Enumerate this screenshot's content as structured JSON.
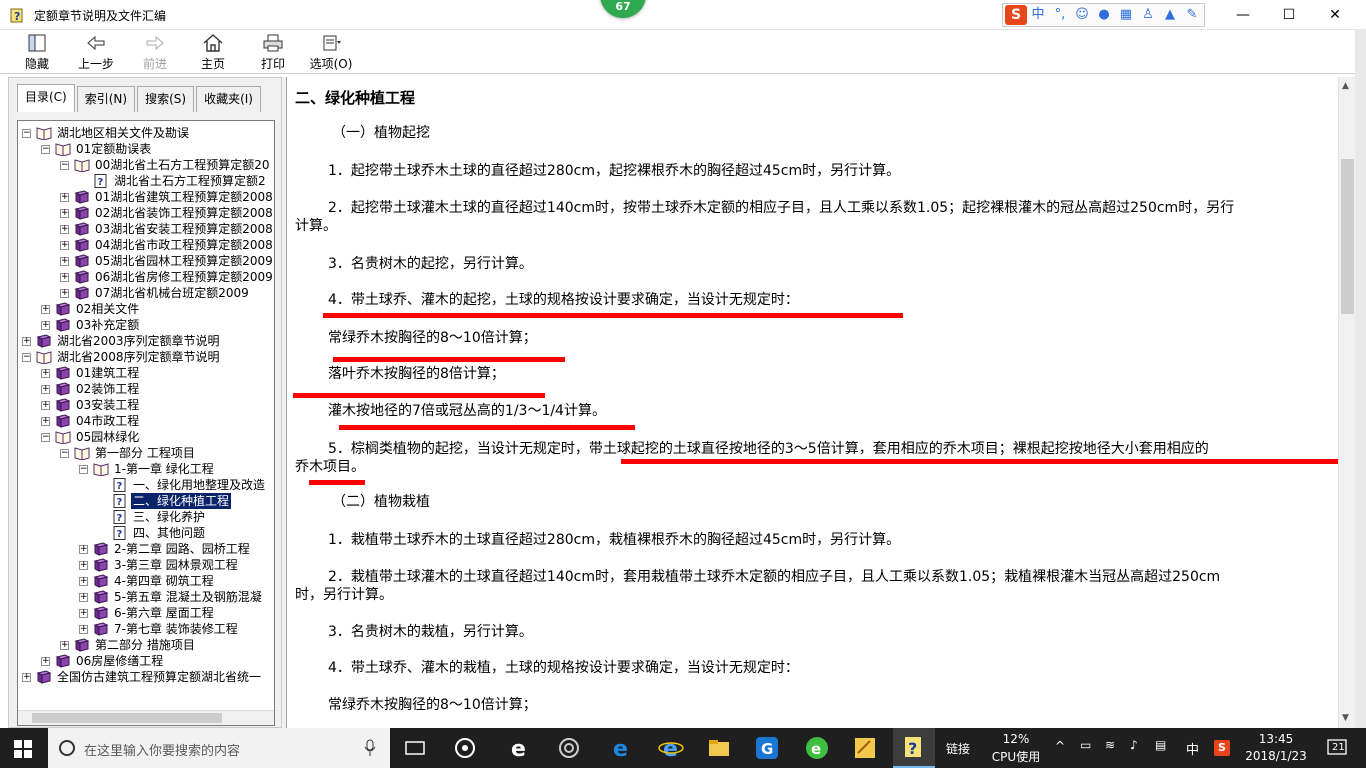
{
  "window": {
    "title": "定额章节说明及文件汇编",
    "badge": "67",
    "minimize": "—",
    "maximize": "☐",
    "close": "✕"
  },
  "ime": {
    "logo": "S",
    "lang": "中",
    "punct": "°,"
  },
  "toolbar": [
    {
      "label": "隐藏",
      "icon": "hide-icon",
      "enabled": true
    },
    {
      "label": "上一步",
      "icon": "back-arrow-icon",
      "enabled": true
    },
    {
      "label": "前进",
      "icon": "forward-arrow-icon",
      "enabled": false
    },
    {
      "label": "主页",
      "icon": "home-icon",
      "enabled": true
    },
    {
      "label": "打印",
      "icon": "printer-icon",
      "enabled": true
    },
    {
      "label": "选项(O)",
      "icon": "options-icon",
      "enabled": true
    }
  ],
  "tabs": [
    "目录(C)",
    "索引(N)",
    "搜索(S)",
    "收藏夹(I)"
  ],
  "tree": [
    {
      "label": "湖北地区相关文件及勘误",
      "level": 0,
      "exp": "−",
      "icon": "book-open"
    },
    {
      "label": "01定额勘误表",
      "level": 1,
      "exp": "−",
      "icon": "book-open"
    },
    {
      "label": "00湖北省土石方工程预算定额20",
      "level": 2,
      "exp": "−",
      "icon": "book-open"
    },
    {
      "label": "湖北省土石方工程预算定额2",
      "level": 3,
      "exp": "",
      "icon": "page"
    },
    {
      "label": "01湖北省建筑工程预算定额2008",
      "level": 2,
      "exp": "+",
      "icon": "book"
    },
    {
      "label": "02湖北省装饰工程预算定额2008",
      "level": 2,
      "exp": "+",
      "icon": "book"
    },
    {
      "label": "03湖北省安装工程预算定额2008",
      "level": 2,
      "exp": "+",
      "icon": "book"
    },
    {
      "label": "04湖北省市政工程预算定额2008",
      "level": 2,
      "exp": "+",
      "icon": "book"
    },
    {
      "label": "05湖北省园林工程预算定额2009",
      "level": 2,
      "exp": "+",
      "icon": "book"
    },
    {
      "label": "06湖北省房修工程预算定额2009",
      "level": 2,
      "exp": "+",
      "icon": "book"
    },
    {
      "label": "07湖北省机械台班定额2009",
      "level": 2,
      "exp": "+",
      "icon": "book"
    },
    {
      "label": "02相关文件",
      "level": 1,
      "exp": "+",
      "icon": "book"
    },
    {
      "label": "03补充定额",
      "level": 1,
      "exp": "+",
      "icon": "book"
    },
    {
      "label": "湖北省2003序列定额章节说明",
      "level": 0,
      "exp": "+",
      "icon": "book"
    },
    {
      "label": "湖北省2008序列定额章节说明",
      "level": 0,
      "exp": "−",
      "icon": "book-open"
    },
    {
      "label": "01建筑工程",
      "level": 1,
      "exp": "+",
      "icon": "book"
    },
    {
      "label": "02装饰工程",
      "level": 1,
      "exp": "+",
      "icon": "book"
    },
    {
      "label": "03安装工程",
      "level": 1,
      "exp": "+",
      "icon": "book"
    },
    {
      "label": "04市政工程",
      "level": 1,
      "exp": "+",
      "icon": "book"
    },
    {
      "label": "05园林绿化",
      "level": 1,
      "exp": "−",
      "icon": "book-open"
    },
    {
      "label": "第一部分 工程项目",
      "level": 2,
      "exp": "−",
      "icon": "book-open"
    },
    {
      "label": "1-第一章 绿化工程",
      "level": 3,
      "exp": "−",
      "icon": "book-open"
    },
    {
      "label": "一、绿化用地整理及改造",
      "level": 4,
      "exp": "",
      "icon": "page"
    },
    {
      "label": "二、绿化种植工程",
      "level": 4,
      "exp": "",
      "icon": "page",
      "selected": true
    },
    {
      "label": "三、绿化养护",
      "level": 4,
      "exp": "",
      "icon": "page"
    },
    {
      "label": "四、其他问题",
      "level": 4,
      "exp": "",
      "icon": "page"
    },
    {
      "label": "2-第二章 园路、园桥工程",
      "level": 3,
      "exp": "+",
      "icon": "book"
    },
    {
      "label": "3-第三章 园林景观工程",
      "level": 3,
      "exp": "+",
      "icon": "book"
    },
    {
      "label": "4-第四章 砌筑工程",
      "level": 3,
      "exp": "+",
      "icon": "book"
    },
    {
      "label": "5-第五章 混凝土及钢筋混凝",
      "level": 3,
      "exp": "+",
      "icon": "book"
    },
    {
      "label": "6-第六章 屋面工程",
      "level": 3,
      "exp": "+",
      "icon": "book"
    },
    {
      "label": "7-第七章 装饰装修工程",
      "level": 3,
      "exp": "+",
      "icon": "book"
    },
    {
      "label": "第二部分 措施项目",
      "level": 2,
      "exp": "+",
      "icon": "book"
    },
    {
      "label": "06房屋修缮工程",
      "level": 1,
      "exp": "+",
      "icon": "book"
    },
    {
      "label": "全国仿古建筑工程预算定额湖北省统一",
      "level": 0,
      "exp": "+",
      "icon": "book"
    }
  ],
  "content": {
    "title": "二、绿化种植工程",
    "paragraphs": [
      "（一）植物起挖",
      "1．起挖带土球乔木土球的直径超过280cm，起挖裸根乔木的胸径超过45cm时，另行计算。",
      "2．起挖带土球灌木土球的直径超过140cm时，按带土球乔木定额的相应子目，且人工乘以系数1.05；起挖裸根灌木的冠丛高超过250cm时，另行",
      "计算。",
      "3．名贵树木的起挖，另行计算。",
      "4．带土球乔、灌木的起挖，土球的规格按设计要求确定，当设计无规定时：",
      "常绿乔木按胸径的8～10倍计算；",
      "落叶乔木按胸径的8倍计算；",
      "灌木按地径的7倍或冠丛高的1/3～1/4计算。",
      "5．棕榈类植物的起挖，当设计无规定时，带土球起挖的土球直径按地径的3～5倍计算，套用相应的乔木项目；裸根起挖按地径大小套用相应的",
      "乔木项目。",
      "（二）植物栽植",
      "1．栽植带土球乔木的土球直径超过280cm，栽植裸根乔木的胸径超过45cm时，另行计算。",
      "2．栽植带土球灌木的土球直径超过140cm时，套用栽植带土球乔木定额的相应子目，且人工乘以系数1.05；栽植裸根灌木当冠丛高超过250cm",
      "时，另行计算。",
      "3．名贵树木的栽植，另行计算。",
      "4．带土球乔、灌木的栽植，土球的规格按设计要求确定，当设计无规定时：",
      "常绿乔木按胸径的8～10倍计算；"
    ]
  },
  "taskbar": {
    "search_placeholder": "在这里输入你要搜索的内容",
    "link_label": "链接",
    "cpu_percent": "12%",
    "cpu_label": "CPU使用",
    "ime_lang": "中",
    "time": "13:45",
    "date": "2018/1/23",
    "notify_count": "21"
  },
  "colors": {
    "selection": "#0a246a",
    "annotation": "#ff0000",
    "badge": "#2fa84f"
  }
}
